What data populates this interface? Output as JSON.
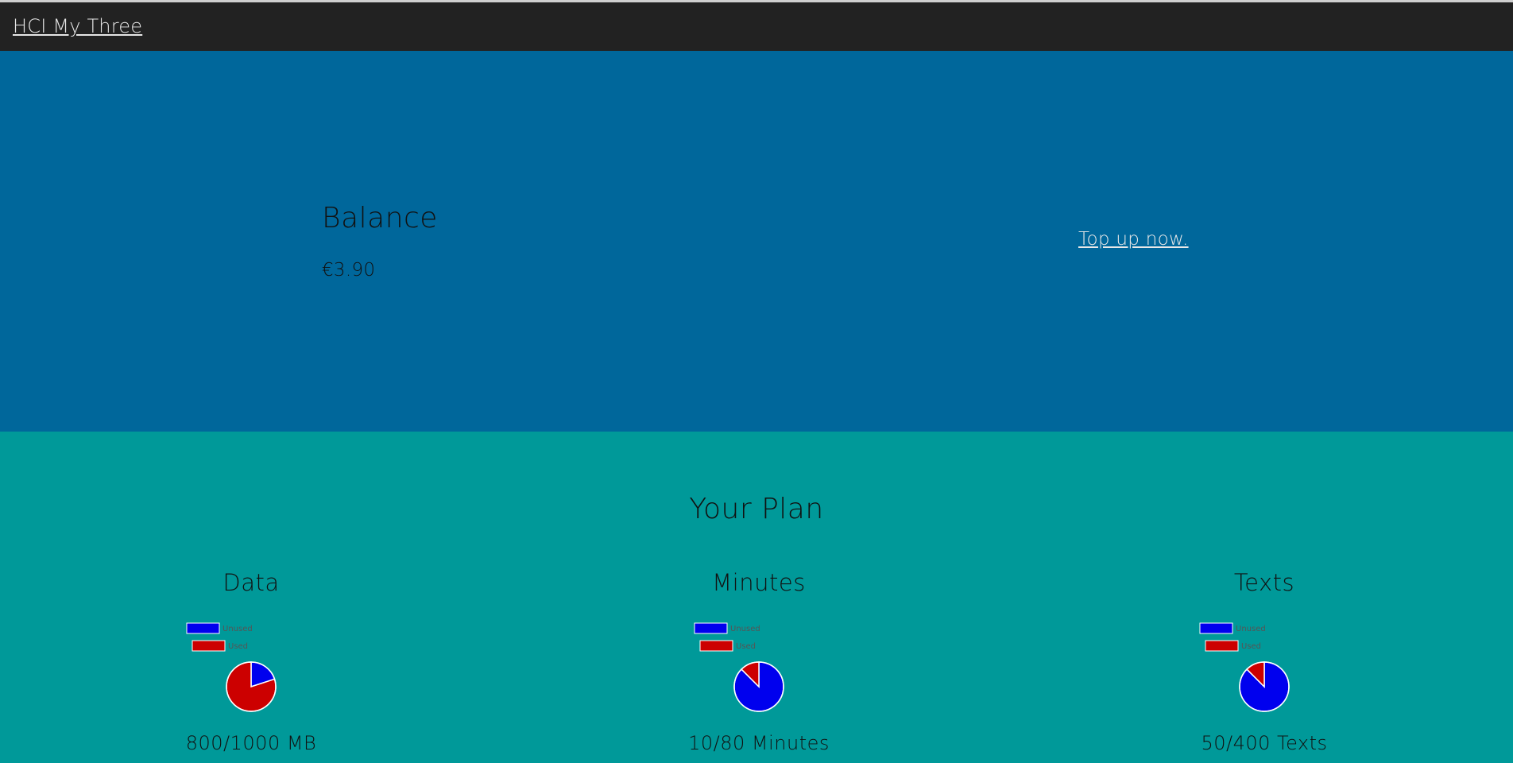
{
  "navbar": {
    "brand": "HCI My Three"
  },
  "balance": {
    "title": "Balance",
    "amount": "€3.90",
    "topup_label": "Top up now."
  },
  "plan": {
    "title": "Your Plan",
    "items": [
      {
        "title": "Data",
        "caption": "800/1000 MB",
        "legend": [
          "Unused",
          "Used"
        ]
      },
      {
        "title": "Minutes",
        "caption": "10/80 Minutes",
        "legend": [
          "Unused",
          "Used"
        ]
      },
      {
        "title": "Texts",
        "caption": "50/400 Texts",
        "legend": [
          "Unused",
          "Used"
        ]
      }
    ]
  },
  "colors": {
    "navbar": "#222222",
    "balance_bg": "#00679b",
    "plan_bg": "#009999",
    "unused": "#0000ee",
    "used": "#cc0000"
  },
  "chart_data": [
    {
      "type": "pie",
      "title": "Data",
      "categories": [
        "Unused",
        "Used"
      ],
      "values": [
        200,
        800
      ]
    },
    {
      "type": "pie",
      "title": "Minutes",
      "categories": [
        "Unused",
        "Used"
      ],
      "values": [
        70,
        10
      ]
    },
    {
      "type": "pie",
      "title": "Texts",
      "categories": [
        "Unused",
        "Used"
      ],
      "values": [
        350,
        50
      ]
    }
  ]
}
